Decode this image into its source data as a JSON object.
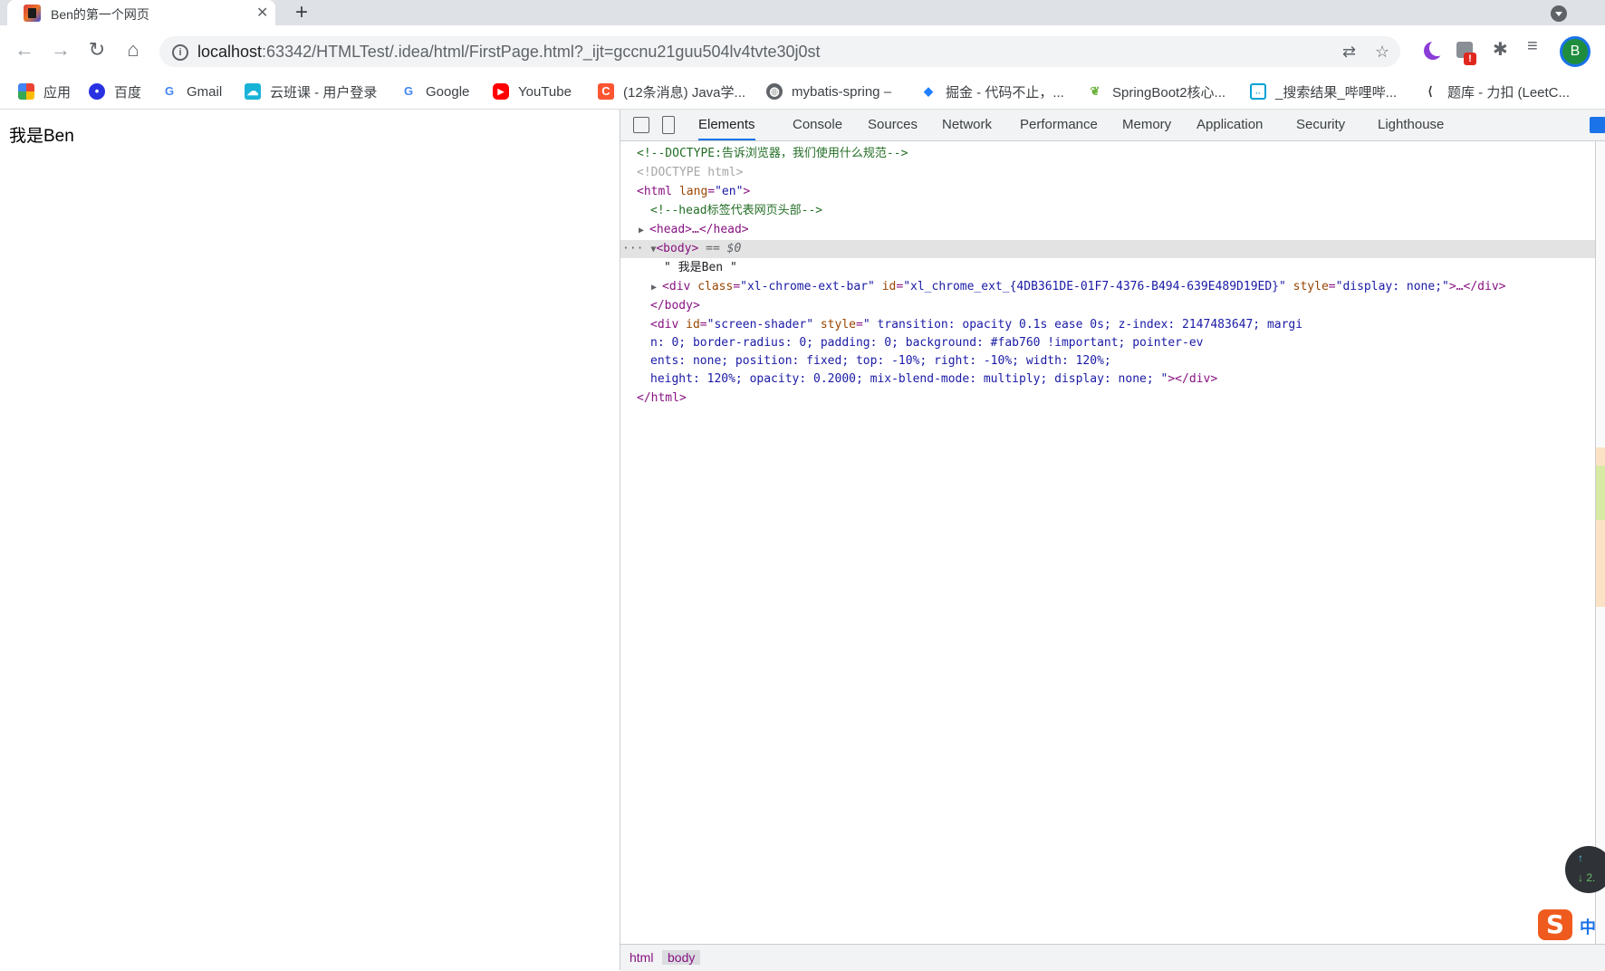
{
  "browser": {
    "tab_title": "Ben的第一个网页",
    "tab_close": "✕",
    "new_tab": "+",
    "url_host": "localhost",
    "url_rest": ":63342/HTMLTest/.idea/html/FirstPage.html?_ijt=gccnu21guu504lv4tvte30j0st",
    "profile_initial": "B",
    "ext_badge": "!"
  },
  "nav": {
    "back_icon": "←",
    "forward_icon": "→",
    "reload_icon": "↻",
    "home_icon": "⌂",
    "info_icon": "i",
    "translate_icon": "🌐",
    "star_icon": "☆",
    "puzzle_icon": "✚",
    "media_icon": "≡"
  },
  "bookmarks": [
    {
      "label": "应用",
      "icon": "apps-grid-icon",
      "color": "#4285f4"
    },
    {
      "label": "百度",
      "icon": "baidu-paw-icon",
      "color": "#2932e1"
    },
    {
      "label": "Gmail",
      "icon": "google-g-icon",
      "color": "#4285f4"
    },
    {
      "label": "云班课 - 用户登录",
      "icon": "cloud-class-icon",
      "color": "#1ab3d8"
    },
    {
      "label": "Google",
      "icon": "google-g-icon",
      "color": "#4285f4"
    },
    {
      "label": "YouTube",
      "icon": "youtube-icon",
      "color": "#ff0000"
    },
    {
      "label": "(12条消息) Java学...",
      "icon": "csdn-c-icon",
      "color": "#fc5531"
    },
    {
      "label": "mybatis-spring –",
      "icon": "globe-icon",
      "color": "#5f6368"
    },
    {
      "label": "掘金 - 代码不止，...",
      "icon": "juejin-icon",
      "color": "#1e80ff"
    },
    {
      "label": "SpringBoot2核心...",
      "icon": "leaf-icon",
      "color": "#6db33f"
    },
    {
      "label": "_搜索结果_哔哩哔...",
      "icon": "bilibili-icon",
      "color": "#00a1d6"
    },
    {
      "label": "题库 - 力扣 (LeetC...",
      "icon": "leetcode-icon",
      "color": "#333333"
    }
  ],
  "page": {
    "body_text": "我是Ben"
  },
  "devtools": {
    "tabs": [
      "Elements",
      "Console",
      "Sources",
      "Network",
      "Performance",
      "Memory",
      "Application",
      "Security",
      "Lighthouse"
    ],
    "active_tab": "Elements",
    "code": {
      "l1": "<!--DOCTYPE:告诉浏览器，我们使用什么规范-->",
      "l2": "<!DOCTYPE html>",
      "l3_tag": "<html ",
      "l3_attr": "lang",
      "l3_val": "\"en\"",
      "l3_end": ">",
      "l4": "<!--head标签代表网页头部-->",
      "l5": "<head>…</head>",
      "l6_tag": "<body>",
      "l6_sel": " == $0",
      "l7": "\" 我是Ben \"",
      "l8_open": "<div ",
      "l8_a1": "class",
      "l8_v1": "\"xl-chrome-ext-bar\"",
      "l8_a2": " id",
      "l8_v2": "\"xl_chrome_ext_{4DB361DE-01F7-4376-B494-639E489D19ED}\"",
      "l8_a3": " style",
      "l8_v3": "\"display: none;\"",
      "l8_end": ">…</div>",
      "l9": "</body>",
      "l10_open": "<div ",
      "l10_a1": "id",
      "l10_v1": "\"screen-shader\"",
      "l10_a2": " style",
      "l10_v2": "\"            transition: opacity 0.1s ease 0s;             z-index: 2147483647;             margi",
      "l11": "n: 0;             border-radius: 0;             padding: 0;             background: #fab760 !important;             pointer-ev",
      "l12": "ents: none;             position: fixed;             top: -10%;             right: -10%;             width: 120%;",
      "l13_v": "height: 120%;             opacity: 0.2000;             mix-blend-mode: multiply;             display: none;         \"",
      "l13_end": "></div>",
      "l14": "</html>",
      "ellipsis": "···"
    },
    "breadcrumbs": [
      "html",
      "body"
    ]
  },
  "widgets": {
    "speed_up": "↑",
    "speed_down": "↓ 2.",
    "ime_logo": "S",
    "ime_mode": "中"
  }
}
